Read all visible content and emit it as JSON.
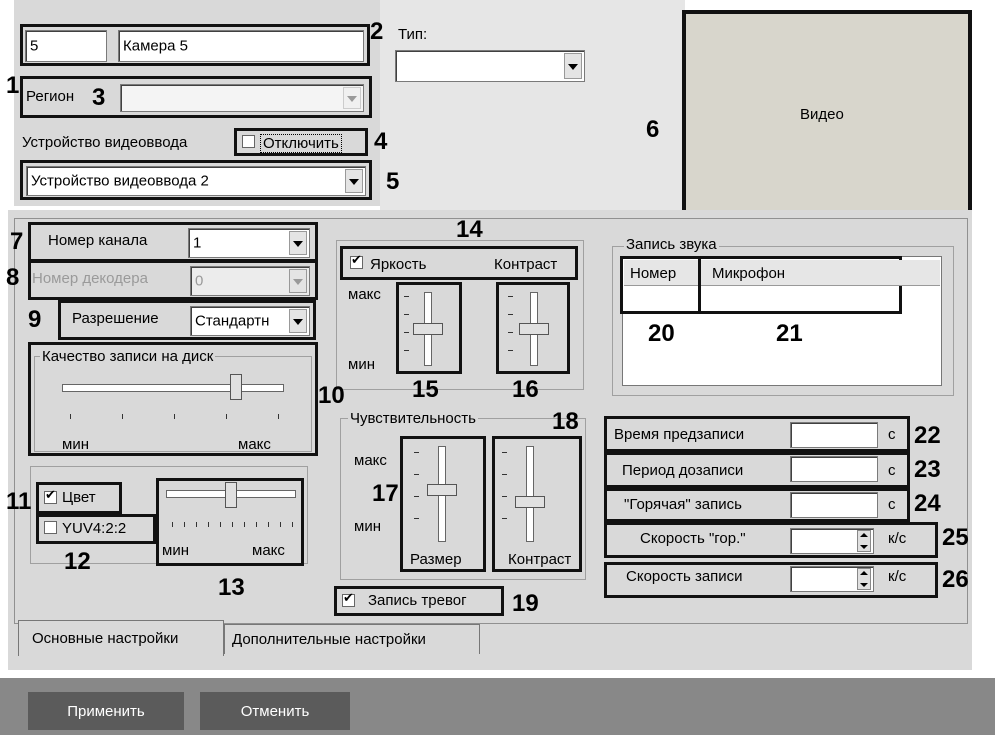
{
  "camera": {
    "id": "5",
    "name": "Камера 5"
  },
  "type": {
    "label": "Тип:",
    "value": ""
  },
  "region": {
    "label": "Регион",
    "value": ""
  },
  "video_device": {
    "label": "Устройство видеоввода",
    "disable_label": "Отключить",
    "disable_checked": false,
    "selected": "Устройство видеоввода 2"
  },
  "video_preview": {
    "label": "Видео"
  },
  "channel": {
    "label": "Номер канала",
    "value": "1"
  },
  "decoder": {
    "label": "Номер декодера",
    "value": "0",
    "enabled": false
  },
  "resolution": {
    "label": "Разрешение",
    "value": "Стандартн"
  },
  "quality": {
    "title": "Качество записи на диск",
    "min": "мин",
    "max": "макс",
    "level": 0.8
  },
  "color": {
    "label": "Цвет",
    "checked": true,
    "yuv_label": "YUV4:2:2",
    "yuv_checked": false,
    "min": "мин",
    "max": "макс",
    "level": 0.5
  },
  "image": {
    "brightness_label": "Яркость",
    "brightness_checked": true,
    "contrast_label": "Контраст",
    "max": "макс",
    "min": "мин",
    "brightness_level": 0.5,
    "contrast_level": 0.5
  },
  "sensitivity": {
    "title": "Чувствительность",
    "max": "макс",
    "min": "мин",
    "size_label": "Размер",
    "contrast_label": "Контраст",
    "size_level": 0.55,
    "contrast_level": 0.4
  },
  "alarm_record": {
    "label": "Запись тревог",
    "checked": true
  },
  "audio": {
    "title": "Запись звука",
    "col_number": "Номер",
    "col_mic": "Микрофон"
  },
  "timings": {
    "prerecord": {
      "label": "Время предзаписи",
      "value": "",
      "unit": "с"
    },
    "postrecord": {
      "label": "Период дозаписи",
      "value": "",
      "unit": "с"
    },
    "hot_record": {
      "label": "\"Горячая\" запись",
      "value": "",
      "unit": "с"
    },
    "hot_speed": {
      "label": "Скорость \"гор.\"",
      "value": "",
      "unit": "к/с"
    },
    "rec_speed": {
      "label": "Скорость записи",
      "value": "",
      "unit": "к/с"
    }
  },
  "tabs": {
    "main": "Основные настройки",
    "advanced": "Дополнительные настройки"
  },
  "buttons": {
    "apply": "Применить",
    "cancel": "Отменить"
  },
  "callouts": [
    "1",
    "2",
    "3",
    "4",
    "5",
    "6",
    "7",
    "8",
    "9",
    "10",
    "11",
    "12",
    "13",
    "14",
    "15",
    "16",
    "17",
    "18",
    "19",
    "20",
    "21",
    "22",
    "23",
    "24",
    "25",
    "26"
  ],
  "colors": {
    "panel": "#d9d9d9",
    "footer": "#888888",
    "button": "#5b5b5b",
    "annotation": "#111111"
  }
}
